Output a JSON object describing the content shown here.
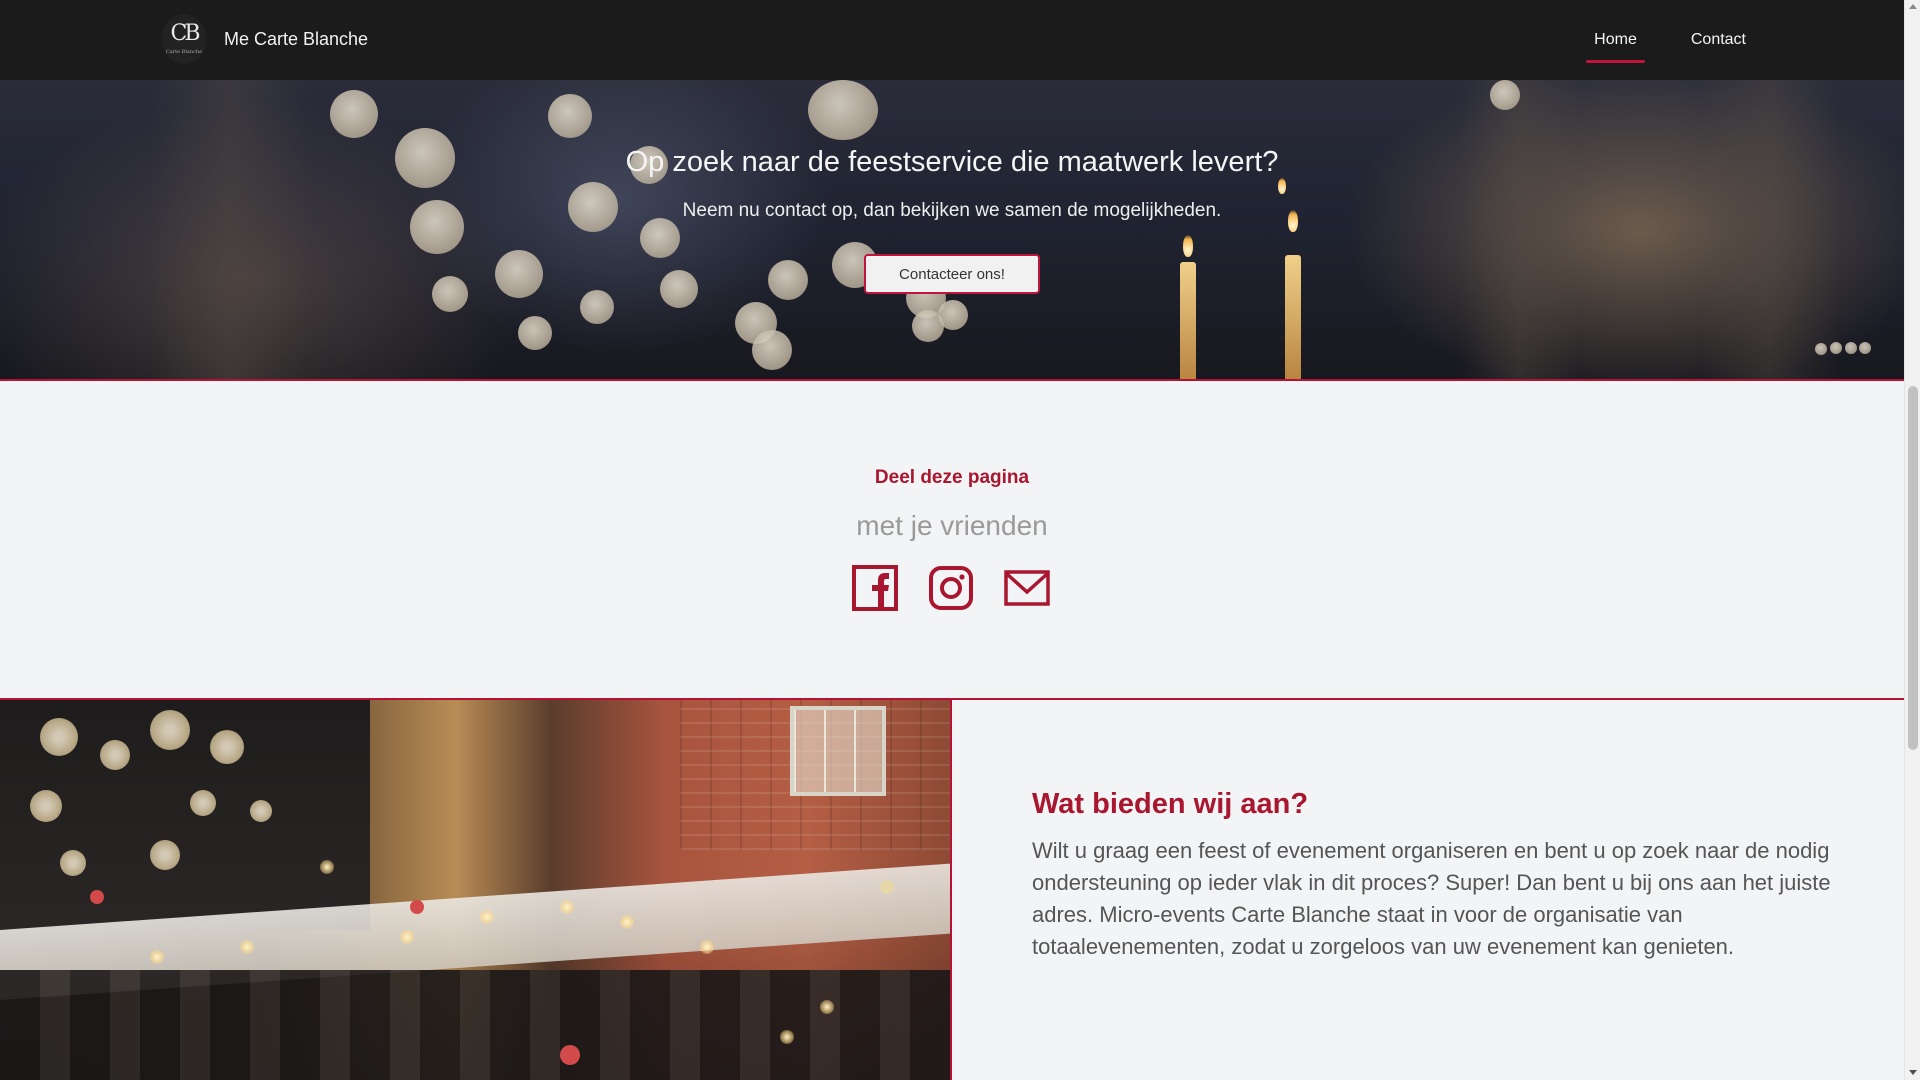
{
  "colors": {
    "accent": "#a8162f",
    "nav_bg": "#1b1b1b",
    "page_bg": "#f3f4f6"
  },
  "navbar": {
    "logo_mark": "CB",
    "logo_sub": "Carte Blanche",
    "brand_name": "Me Carte Blanche",
    "links": [
      {
        "label": "Home",
        "active": true
      },
      {
        "label": "Contact",
        "active": false
      }
    ]
  },
  "hero": {
    "title": "Op zoek naar de feestservice die maatwerk levert?",
    "subtitle": "Neem nu contact op, dan bekijken we samen de mogelijkheden.",
    "cta_label": "Contacteer ons!"
  },
  "share": {
    "title": "Deel deze pagina",
    "subtitle": "met je vrienden",
    "icons": [
      "facebook-icon",
      "instagram-icon",
      "mail-icon"
    ]
  },
  "offer": {
    "title": "Wat bieden wij aan?",
    "body": "Wilt u graag een feest of evenement organiseren en bent u op zoek naar de nodig ondersteuning op ieder vlak in dit proces? Super! Dan bent u bij ons aan het juiste adres. Micro-events Carte Blanche staat in voor de organisatie van totaalevenementen, zodat u zorgeloos van uw evenement kan genieten."
  }
}
